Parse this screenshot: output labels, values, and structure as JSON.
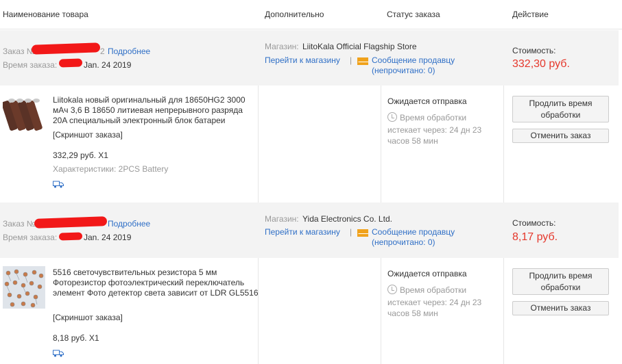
{
  "header": {
    "col_product": "Наименование товара",
    "col_extra": "Дополнительно",
    "col_status": "Статус заказа",
    "col_action": "Действие"
  },
  "orders": [
    {
      "order_label": "Заказ №",
      "order_suffix": "2",
      "details_link": "Подробнее",
      "time_label": "Время заказа:",
      "time_value": "Jan. 24 2019",
      "store_label": "Магазин:",
      "store_name": "LiitoKala Official Flagship Store",
      "go_store": "Перейти к магазину",
      "separator": "|",
      "message_link": "Сообщение продавцу",
      "unread": "(непрочитано: 0)",
      "cost_label": "Стоимость:",
      "cost_value": "332,30 руб.",
      "item_title": "Liitokala новый оригинальный для 18650HG2 3000 мАч 3,6 В 18650 литиевая непрерывного разряда 20A специальный электронный блок батареи",
      "snapshot": "[Скриншот заказа]",
      "price_qty": "332,29 руб. X1",
      "specs": "Характеристики: 2PCS Battery",
      "status": "Ожидается отправка",
      "processing_line1": "Время обработки",
      "processing_line2": "истекает через: 24 дн 23",
      "processing_line3": "часов 58 мин",
      "extend_button": "Продлить время обработки",
      "cancel_button": "Отменить заказ"
    },
    {
      "order_label": "Заказ №",
      "order_suffix": "",
      "details_link": "Подробнее",
      "time_label": "Время заказа:",
      "time_value": "Jan. 24 2019",
      "store_label": "Магазин:",
      "store_name": "Yida Electronics Co. Ltd.",
      "go_store": "Перейти к магазину",
      "separator": "|",
      "message_link": "Сообщение продавцу",
      "unread": "(непрочитано: 0)",
      "cost_label": "Стоимость:",
      "cost_value": "8,17 руб.",
      "item_title": "5516 светочувствительных резистора 5 мм Фоторезистор фотоэлектрический переключатель элемент Фото детектор света зависит от LDR GL5516",
      "snapshot": "[Скриншот заказа]",
      "price_qty": "8,18 руб. X1",
      "status": "Ожидается отправка",
      "processing_line1": "Время обработки",
      "processing_line2": "истекает через: 24 дн 23",
      "processing_line3": "часов 58 мин",
      "extend_button": "Продлить время обработки",
      "cancel_button": "Отменить заказ"
    }
  ]
}
